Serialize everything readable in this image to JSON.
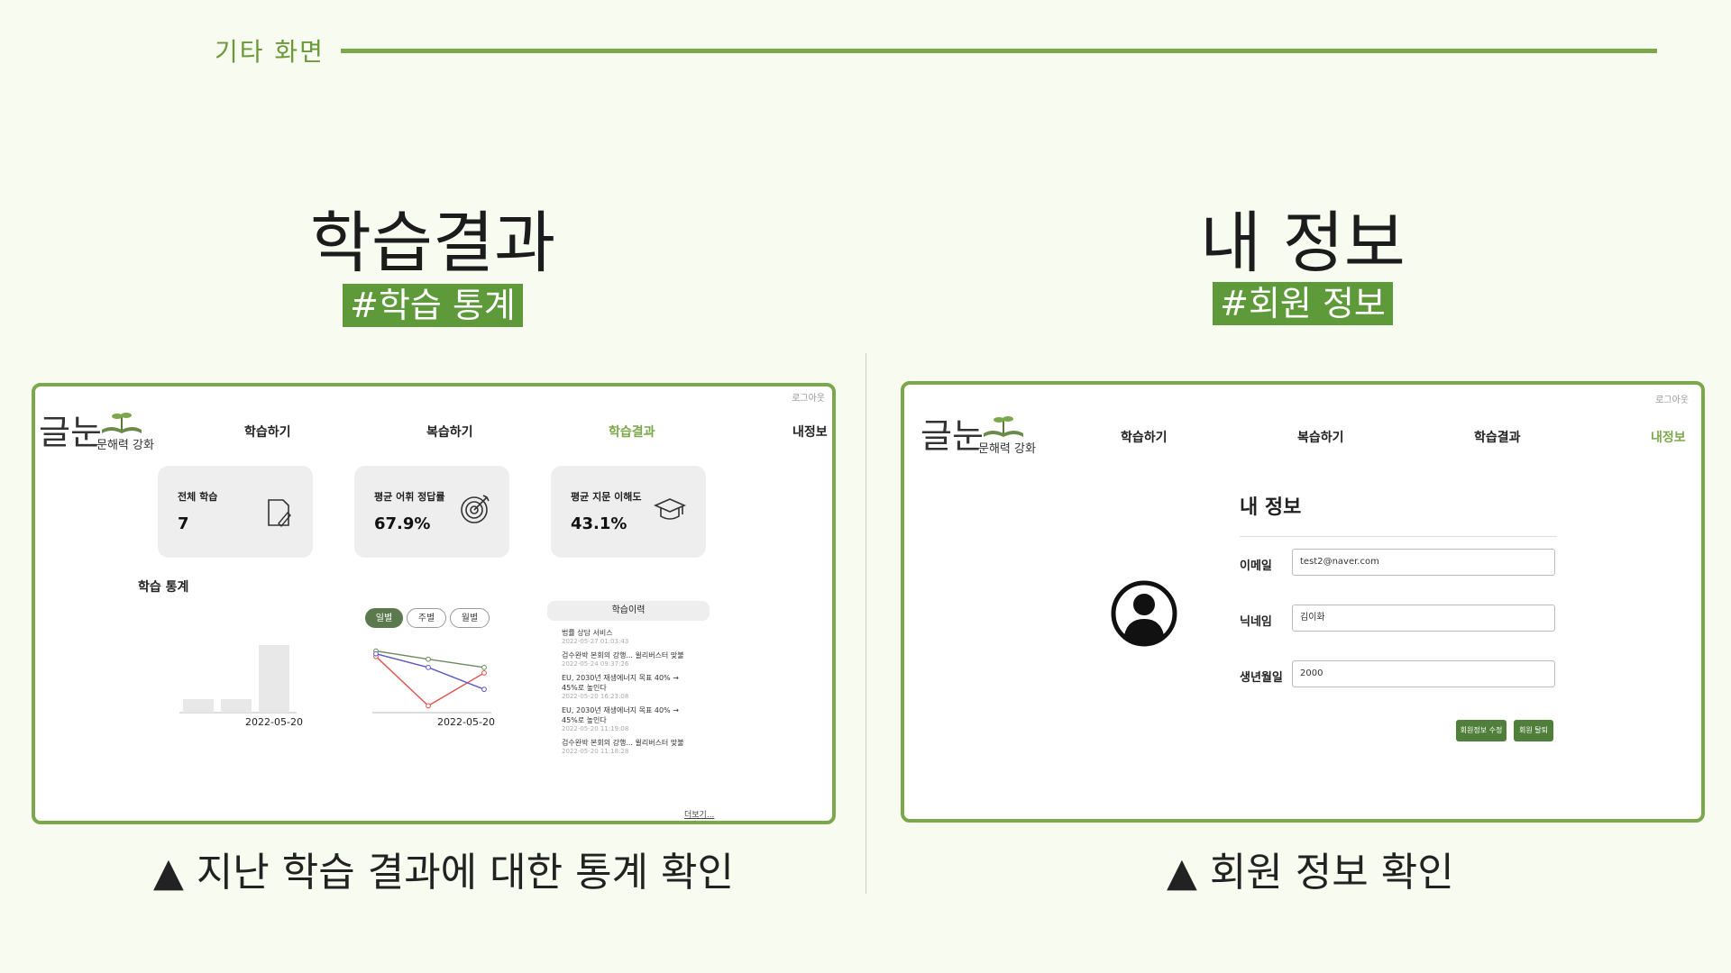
{
  "slide": {
    "section_label": "기타 화면",
    "left": {
      "title": "학습결과",
      "tag": "#학습 통계",
      "caption": "▲ 지난 학습 결과에 대한 통계 확인"
    },
    "right": {
      "title": "내 정보",
      "tag": "#회원 정보",
      "caption": "▲ 회원 정보 확인"
    }
  },
  "results_app": {
    "logo": {
      "main": "글눈",
      "sub": "문해력 강화"
    },
    "logout": "로그아웃",
    "nav": [
      "학습하기",
      "복습하기",
      "학습결과",
      "내정보"
    ],
    "active_nav": "학습결과",
    "stats": [
      {
        "label": "전체 학습",
        "value": "7",
        "icon": "document-pen-icon"
      },
      {
        "label": "평균 어휘 정답률",
        "value": "67.9%",
        "icon": "target-icon"
      },
      {
        "label": "평균 지문 이해도",
        "value": "43.1%",
        "icon": "graduation-cap-icon"
      }
    ],
    "stats_heading": "학습 통계",
    "period_tabs": [
      "일별",
      "주별",
      "월별"
    ],
    "active_period": "일별",
    "history": {
      "title": "학습이력",
      "items": [
        {
          "title": "법률 상담 서비스",
          "date": "2022-05-27 01:03:43"
        },
        {
          "title": "검수완박 본회의 강행... 윌리버스터 맞불",
          "date": "2022-05-24 09:37:26"
        },
        {
          "title": "EU, 2030년 재생에너지 목표 40% → 45%로 높인다",
          "date": "2022-05-20 16:23:08"
        },
        {
          "title": "EU, 2030년 재생에너지 목표 40% → 45%로 높인다",
          "date": "2022-05-20 11:19:08"
        },
        {
          "title": "검수완박 본회의 강행... 윌리버스터 맞불",
          "date": "2022-05-20 11:18:28"
        }
      ],
      "more": "더보기..."
    }
  },
  "chart_data": [
    {
      "type": "bar",
      "categories": [
        "",
        "",
        "2022-05-20"
      ],
      "values": [
        1,
        1,
        5
      ],
      "ylim": [
        0,
        6
      ],
      "color": "#e8e8e8"
    },
    {
      "type": "line",
      "categories": [
        "",
        "",
        "2022-05-20"
      ],
      "series": [
        {
          "color": "#6b8a5a",
          "values": [
            90,
            78,
            66
          ]
        },
        {
          "color": "#e0524a",
          "values": [
            82,
            10,
            58
          ]
        },
        {
          "color": "#5a55c8",
          "values": [
            86,
            66,
            34
          ]
        }
      ],
      "ylim": [
        0,
        100
      ]
    }
  ],
  "profile_app": {
    "logo": {
      "main": "글눈",
      "sub": "문해력 강화"
    },
    "logout": "로그아웃",
    "nav": [
      "학습하기",
      "복습하기",
      "학습결과",
      "내정보"
    ],
    "active_nav": "내정보",
    "heading": "내 정보",
    "avatar_icon": "user-avatar-icon",
    "fields": [
      {
        "label": "이메일",
        "value": "test2@naver.com"
      },
      {
        "label": "닉네임",
        "value": "김이화"
      },
      {
        "label": "생년월일",
        "value": "2000"
      }
    ],
    "buttons": {
      "edit": "회원정보 수정",
      "withdraw": "회원 탈퇴"
    }
  }
}
